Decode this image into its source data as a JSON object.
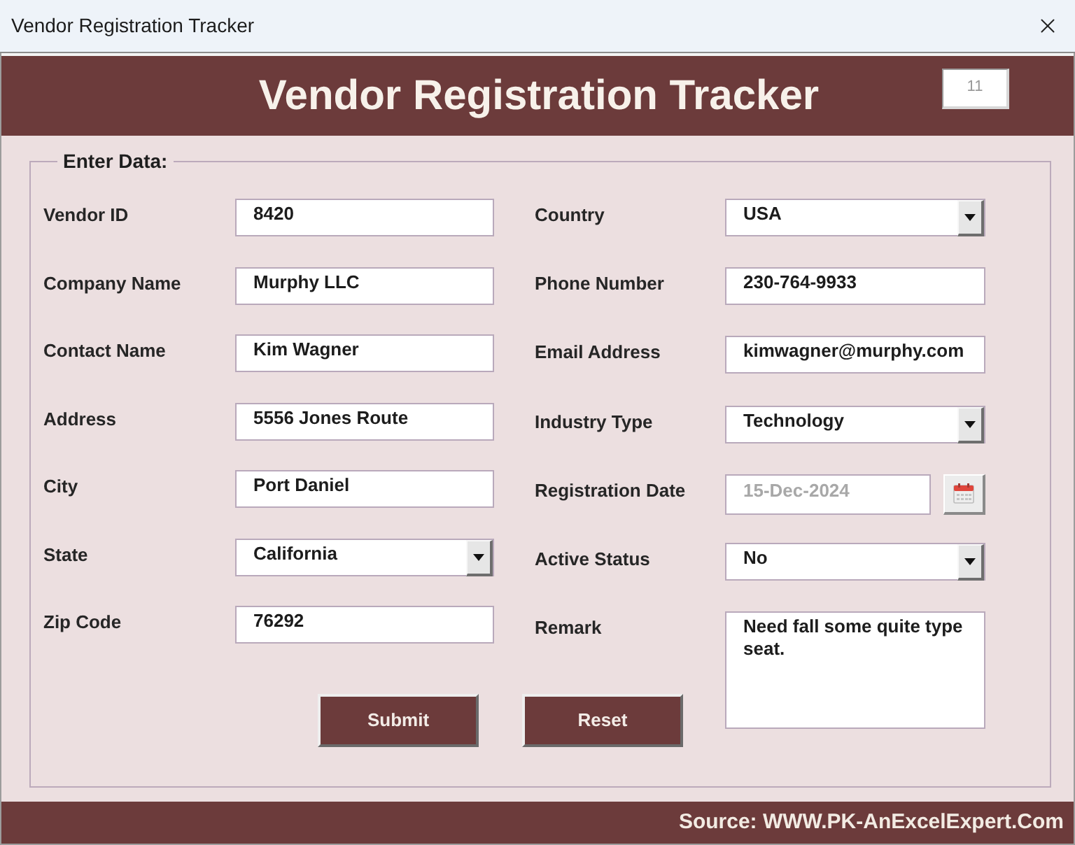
{
  "window": {
    "title": "Vendor Registration Tracker"
  },
  "header": {
    "title": "Vendor Registration Tracker",
    "record_count": "11"
  },
  "entry_frame": {
    "caption": "Enter Data:"
  },
  "left_fields": [
    {
      "kind": "text",
      "label": "Vendor ID",
      "value": "8420",
      "disabled": false
    },
    {
      "kind": "text",
      "label": "Company Name",
      "value": "Murphy LLC",
      "disabled": false
    },
    {
      "kind": "text",
      "label": "Contact Name",
      "value": "Kim Wagner",
      "disabled": false
    },
    {
      "kind": "text",
      "label": "Address",
      "value": "5556 Jones Route",
      "disabled": false
    },
    {
      "kind": "text",
      "label": "City",
      "value": "Port Daniel",
      "disabled": false
    },
    {
      "kind": "dropdown",
      "label": "State",
      "value": "California",
      "disabled": false
    },
    {
      "kind": "text",
      "label": "Zip Code",
      "value": "76292",
      "disabled": false
    }
  ],
  "right_fields": [
    {
      "kind": "dropdown",
      "label": "Country",
      "value": "USA",
      "disabled": false
    },
    {
      "kind": "text",
      "label": "Phone Number",
      "value": "230-764-9933",
      "disabled": false
    },
    {
      "kind": "text",
      "label": "Email Address",
      "value": "kimwagner@murphy.com",
      "disabled": false
    },
    {
      "kind": "dropdown",
      "label": "Industry Type",
      "value": "Technology",
      "disabled": false
    },
    {
      "kind": "date",
      "label": "Registration Date",
      "value": "15-Dec-2024",
      "disabled": true
    },
    {
      "kind": "dropdown",
      "label": "Active Status",
      "value": "No",
      "disabled": false
    },
    {
      "kind": "textarea",
      "label": "Remark",
      "value": "Need fall some quite type seat.",
      "disabled": false
    }
  ],
  "buttons": [
    {
      "label": "Submit"
    },
    {
      "label": "Reset"
    }
  ],
  "footer": {
    "source": "Source: WWW.PK-AnExcelExpert.Com"
  }
}
